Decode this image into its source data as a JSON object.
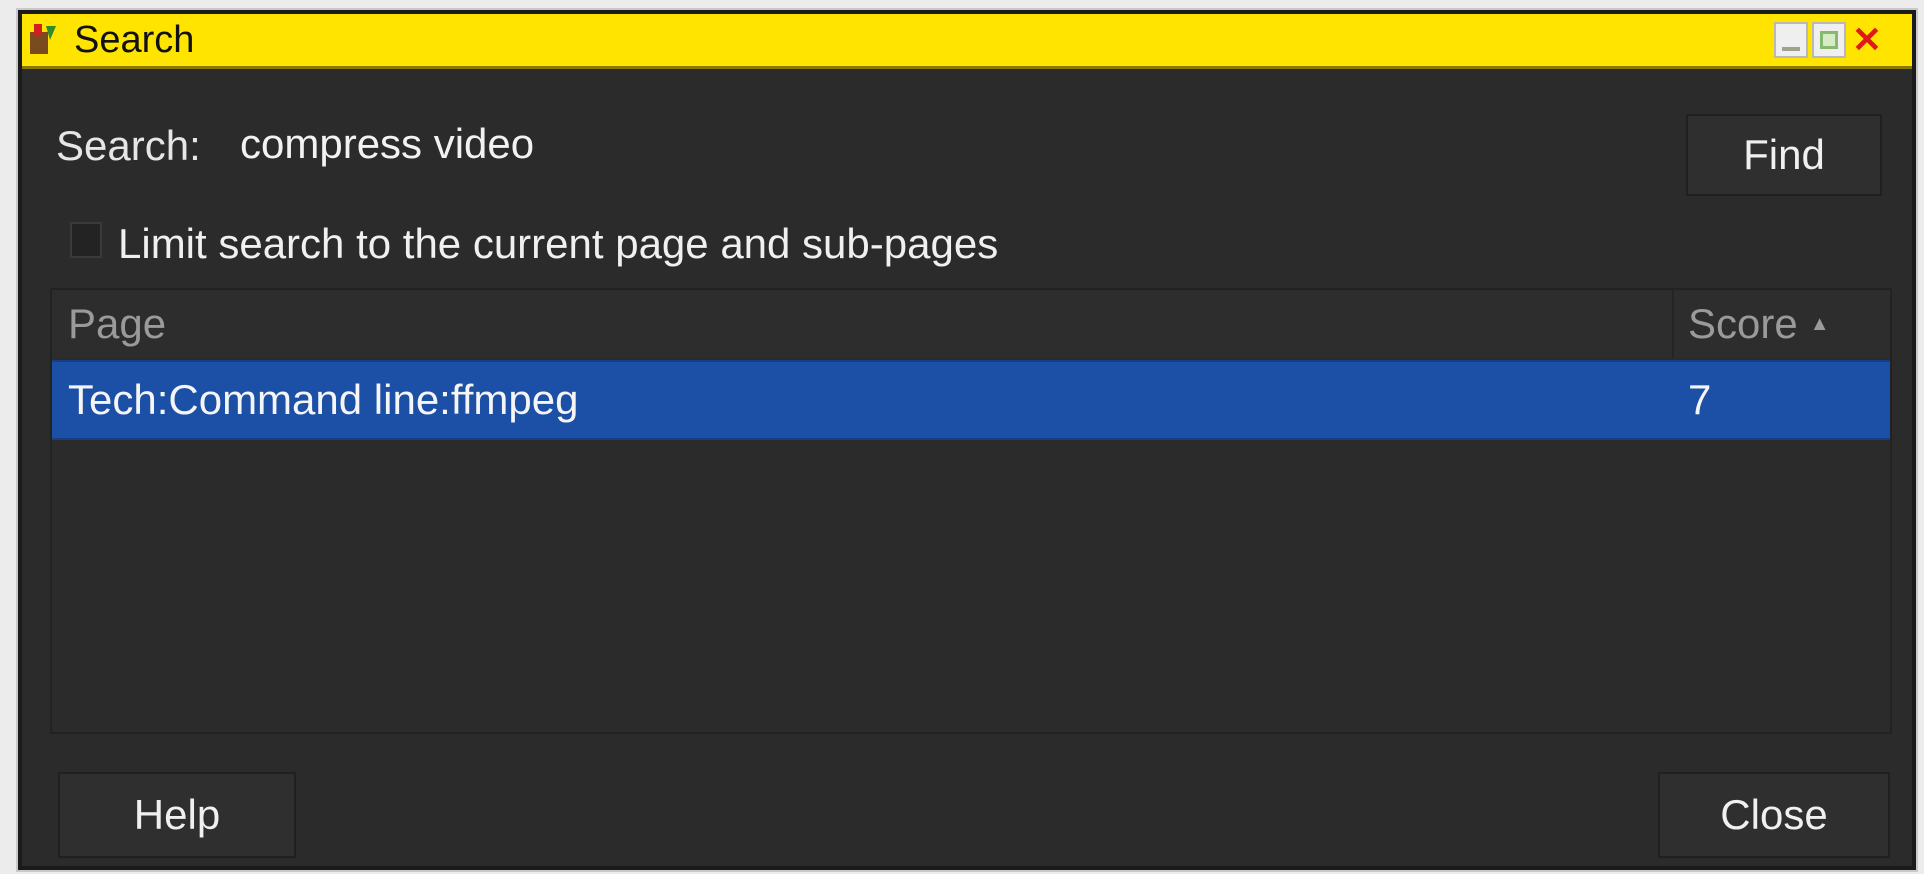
{
  "window": {
    "title": "Search",
    "titlebar_color": "#ffe400",
    "controls": {
      "minimize_icon": "minimize-icon",
      "maximize_icon": "maximize-icon",
      "close_icon": "close-icon",
      "close_glyph": "✕"
    },
    "app_icon": "app-icon"
  },
  "search": {
    "label": "Search:",
    "value": "compress video",
    "find_label": "Find"
  },
  "limit": {
    "label": "Limit search to the current page and sub-pages",
    "checked": false
  },
  "results": {
    "columns": {
      "page": "Page",
      "score": "Score",
      "sort_icon": "sort-ascending-icon",
      "sort_glyph": "▲"
    },
    "rows": [
      {
        "page": "Tech:Command line:ffmpeg",
        "score": "7",
        "selected": true
      }
    ],
    "selection_color": "#1c4fa6"
  },
  "footer": {
    "help_label": "Help",
    "close_label": "Close"
  }
}
